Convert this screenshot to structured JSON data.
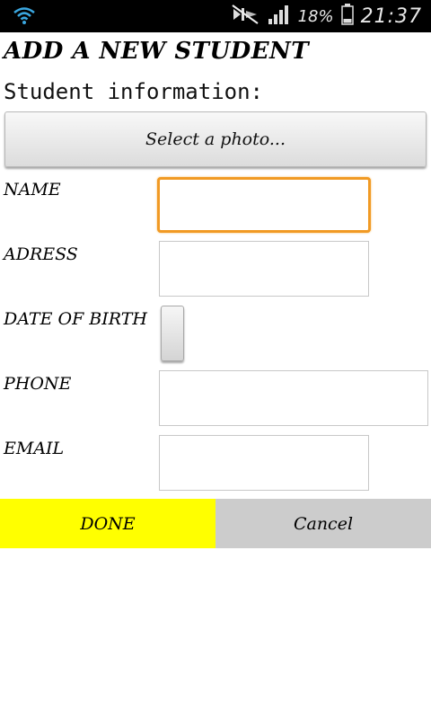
{
  "statusbar": {
    "battery_percent": "18%",
    "time": "21:37",
    "icons": [
      "wifi-icon",
      "mute-icon",
      "signal-icon",
      "battery-icon"
    ]
  },
  "form": {
    "title": "ADD A NEW STUDENT",
    "subtitle": "Student information:",
    "photo_button_label": "Select a photo...",
    "fields": {
      "name_label": "NAME",
      "address_label": "ADRESS",
      "dob_label": "DATE OF BIRTH",
      "phone_label": "PHONE",
      "email_label": "EMAIL"
    },
    "values": {
      "name": "",
      "address": "",
      "phone": "",
      "email": ""
    }
  },
  "actions": {
    "done_label": "DONE",
    "cancel_label": "Cancel"
  },
  "colors": {
    "focus": "#f19a24",
    "done_bg": "#ffff00",
    "cancel_bg": "#cccccc",
    "statusbar_bg": "#000000"
  }
}
